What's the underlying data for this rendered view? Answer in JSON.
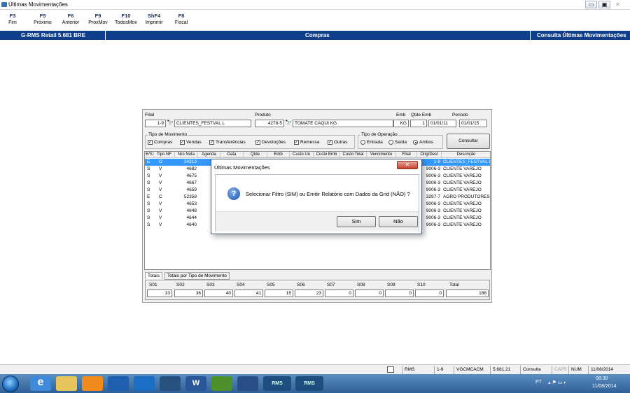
{
  "window": {
    "title": "Últimas Movimentações",
    "controls": [
      "▭",
      "▣",
      "✕"
    ]
  },
  "fkeys": [
    {
      "key": "F3",
      "label": "Fim"
    },
    {
      "key": "F5",
      "label": "Próximo"
    },
    {
      "key": "F6",
      "label": "Anterior"
    },
    {
      "key": "F9",
      "label": "ProxMov"
    },
    {
      "key": "F10",
      "label": "TodosMov"
    },
    {
      "key": "ShF4",
      "label": "Imprimir"
    },
    {
      "key": "F8",
      "label": "Fiscal"
    }
  ],
  "header": {
    "app": "G-RMS Retail 5.681 BRE",
    "module": "Compras",
    "screen": "Consulta Últimas Movimentações",
    "color": "#0f3f8c"
  },
  "form": {
    "filial_label": "Filial",
    "filial_value": "1-9",
    "filial_name": "CLIENTES_FESTVAL L",
    "produto_label": "Produto",
    "produto_value": "4278-5",
    "produto_name": "TOMATE CAQUI KG",
    "emb_label": "Emb",
    "emb_value": "KG",
    "qtde_emb_label": "Qtde Emb",
    "qtde_emb_value": "1",
    "periodo_label": "Período",
    "periodo_from": "01/01/11",
    "periodo_to": "01/01/15",
    "tipo_mov_label": "Tipo de Movimento",
    "tipo_mov": [
      {
        "label": "Compras",
        "checked": "✓"
      },
      {
        "label": "Vendas",
        "checked": "✓"
      },
      {
        "label": "Transferências",
        "checked": "✓"
      },
      {
        "label": "Devoluções",
        "checked": "✓"
      },
      {
        "label": "Remessa",
        "checked": "✓"
      },
      {
        "label": "Outras",
        "checked": "✓"
      }
    ],
    "tipo_op_label": "Tipo de Operação",
    "tipo_op": [
      {
        "label": "Entrada",
        "selected": false
      },
      {
        "label": "Saída",
        "selected": false
      },
      {
        "label": "Ambos",
        "selected": true
      }
    ],
    "consultar_label": "Consultar"
  },
  "grid": {
    "columns": [
      "E/S",
      "Tipo NF",
      "Nro Nota",
      "Agenda",
      "Data",
      "Qtde",
      "Emb",
      "Custo Un",
      "Custo Emb",
      "Custo Total",
      "Vencimento",
      "Filial",
      "Orig/Dest",
      "Descrição"
    ],
    "rows": [
      {
        "es": "E",
        "tipo": "O",
        "nota": "34313",
        "orig": "1-9",
        "desc": "CLIENTES_FESTVAL L"
      },
      {
        "es": "S",
        "tipo": "V",
        "nota": "4682",
        "orig": "9006-3",
        "desc": "CLIENTE VAREJO"
      },
      {
        "es": "S",
        "tipo": "V",
        "nota": "4675",
        "orig": "9006-3",
        "desc": "CLIENTE VAREJO"
      },
      {
        "es": "S",
        "tipo": "V",
        "nota": "4667",
        "orig": "9006-3",
        "desc": "CLIENTE VAREJO"
      },
      {
        "es": "S",
        "tipo": "V",
        "nota": "4659",
        "orig": "9006-3",
        "desc": "CLIENTE VAREJO"
      },
      {
        "es": "E",
        "tipo": "C",
        "nota": "52358",
        "orig": "3297-7",
        "desc": "AGRO PRODUTORES I"
      },
      {
        "es": "S",
        "tipo": "V",
        "nota": "4653",
        "orig": "9006-3",
        "desc": "CLIENTE VAREJO"
      },
      {
        "es": "S",
        "tipo": "V",
        "nota": "4648",
        "orig": "9006-3",
        "desc": "CLIENTE VAREJO"
      },
      {
        "es": "S",
        "tipo": "V",
        "nota": "4644",
        "orig": "9006-3",
        "desc": "CLIENTE VAREJO"
      },
      {
        "es": "S",
        "tipo": "V",
        "nota": "4640",
        "orig": "9006-3",
        "desc": "CLIENTE VAREJO"
      }
    ]
  },
  "tabs": [
    "Totais",
    "Totais por Tipo de Movimento"
  ],
  "totals": {
    "labels": [
      "S01",
      "S02",
      "S03",
      "S04",
      "S05",
      "S06",
      "S07",
      "S08",
      "S09",
      "S10",
      "Total"
    ],
    "values": [
      "33",
      "36",
      "40",
      "41",
      "15",
      "23",
      "0",
      "0",
      "0",
      "0",
      "188"
    ]
  },
  "dialog": {
    "title": "Últimas Movimentações",
    "close": "✕",
    "icon": "?",
    "message": "Selecionar Filtro (SIM) ou Emitir Relatório com Dados da Grid (NÃO) ?",
    "yes": "Sim",
    "no": "Não"
  },
  "statusbar": [
    "RMS",
    "1-9",
    "VGCMCACM",
    "5.681.21",
    "Consulta",
    "CAPS",
    "NUM",
    "11/08/2014"
  ],
  "taskbar": {
    "apps": [
      "start-orb",
      "ie-icon",
      "explorer-icon",
      "media-icon",
      "outlook-icon",
      "lync-icon",
      "app-icon",
      "word-icon",
      "install-icon",
      "chat-icon",
      "rms-1",
      "rms-2"
    ],
    "rms_label": "RMS",
    "lang": "PT",
    "time": "08:30",
    "date": "11/08/2014"
  }
}
